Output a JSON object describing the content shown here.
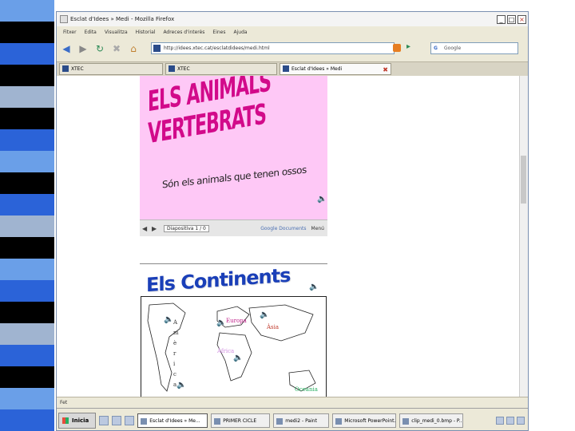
{
  "window": {
    "title": "Esclat d'Idees » Medi - Mozilla Firefox",
    "minimize": "_",
    "maximize": "□",
    "close": "×"
  },
  "menubar": [
    "Fitxer",
    "Edita",
    "Visualitza",
    "Historial",
    "Adreces d'interès",
    "Eines",
    "Ajuda"
  ],
  "toolbar": {
    "url": "http://idees.xtec.cat/esclatdidees/medi.html",
    "search_placeholder": "Google",
    "search_engine_label": "G"
  },
  "tabs": [
    {
      "label": "XTEC",
      "active": false
    },
    {
      "label": "XTEC",
      "active": false
    },
    {
      "label": "Esclat d'Idees » Medi",
      "active": true
    }
  ],
  "slide1": {
    "heading": "ELS ANIMALS VERTEBRATS",
    "subtitle": "Són els animals que tenen ossos",
    "slide_counter": "Diapositiva 1 / 0",
    "google_text": "Google Documents",
    "menu_label": "Menú"
  },
  "slide2": {
    "heading": "Els Continents",
    "labels": {
      "europa": "Europa",
      "asia": "Àsia",
      "africa": "Àfrica",
      "oceania": "Oceania",
      "america_letters": "A m è r i c a"
    }
  },
  "statusbar": {
    "text": "Fet"
  },
  "taskbar": {
    "start_label": "Inicia",
    "items": [
      "Esclat d'Idees » Me...",
      "PRIMER CICLE",
      "medi2 - Paint",
      "Microsoft PowerPoint...",
      "clip_medi_0.bmp - P..."
    ]
  },
  "colors": {
    "slide_bg": "#fec8f6",
    "heading_pink": "#d20a8a",
    "heading_blue": "#1a3fb8",
    "europa": "#c0208a",
    "asia": "#c0392b",
    "africa": "#d08fe0",
    "oceania": "#27ae60",
    "stripe_dark": "#000000",
    "stripe_blue": "#2b63d8",
    "stripe_light": "#6a9fe8",
    "stripe_grey": "#a0b4d0"
  }
}
